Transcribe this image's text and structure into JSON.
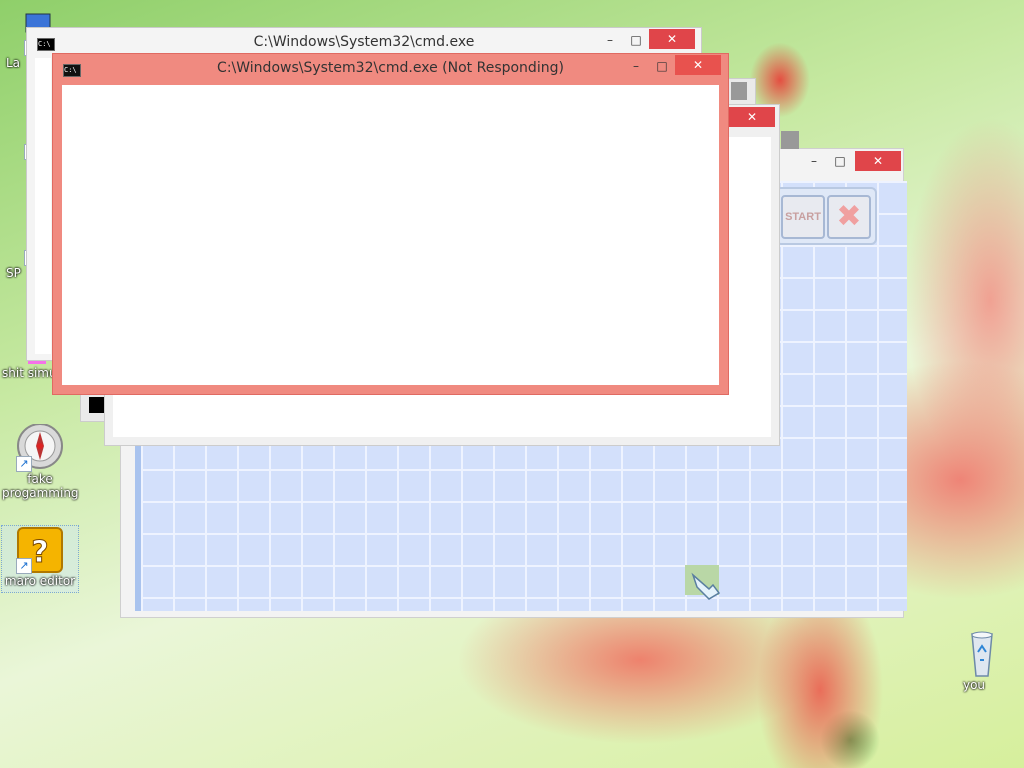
{
  "desktop": {
    "icons": [
      {
        "label": "La"
      },
      {
        "label": ""
      },
      {
        "label": "SP"
      },
      {
        "label": "shit simul"
      },
      {
        "label": "fake progamming"
      },
      {
        "label": "maro editor"
      },
      {
        "label": "you"
      }
    ]
  },
  "windows": {
    "cmd_back": {
      "title": "C:\\Windows\\System32\\cmd.exe",
      "min": "–",
      "max": "□",
      "close": "✕"
    },
    "cmd_front": {
      "title": "C:\\Windows\\System32\\cmd.exe (Not Responding)",
      "min": "–",
      "max": "□",
      "close": "✕"
    },
    "game": {
      "start_label": "START",
      "min": "–",
      "max": "□",
      "close": "✕"
    },
    "mid": {
      "close": "✕"
    }
  },
  "colors": {
    "close": "#e0454a",
    "not_responding_frame": "#f08a80",
    "grid": "#d3e0fb"
  }
}
